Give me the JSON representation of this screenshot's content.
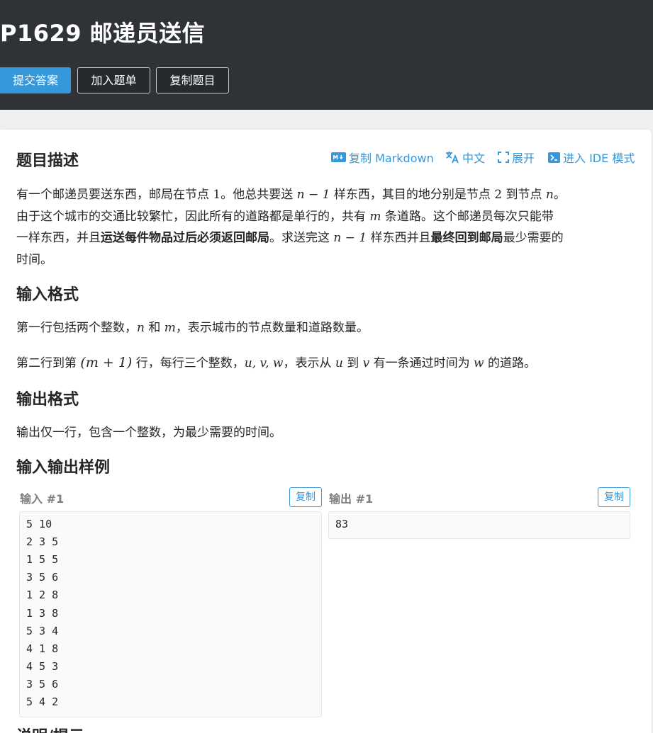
{
  "header": {
    "title": "P1629 邮递员送信",
    "submit_label": "提交答案",
    "add_label": "加入题单",
    "copy_label": "复制题目"
  },
  "toolbar": {
    "markdown_icon": "markdown-icon",
    "markdown_label": "复制 Markdown",
    "translate_icon": "translate-icon",
    "lang_label": "中文",
    "expand_icon": "expand-icon",
    "expand_label": "展开",
    "ide_icon": "terminal-icon",
    "ide_label": "进入 IDE 模式"
  },
  "description": {
    "heading": "题目描述",
    "line1": {
      "a": "有一个邮递员要送东西，邮局在节点 ",
      "b": "1",
      "c": "。他总共要送 ",
      "d": "n − 1",
      "e": " 样东西，其目的地分别是节点 ",
      "f": "2",
      "g": " 到节点 ",
      "h": "n",
      "i": "。"
    },
    "line2": {
      "a": "由于这个城市的交通比较繁忙，因此所有的道路都是单行的，共有 ",
      "b": "m",
      "c": " 条道路。这个邮递员每次只能带"
    },
    "line3": {
      "a": "一样东西，并且",
      "b": "运送每件物品过后必须返回邮局",
      "c": "。求送完这 ",
      "d": "n − 1",
      "e": " 样东西并且",
      "f": "最终回到邮局",
      "g": "最少需要的"
    },
    "line4": "时间。"
  },
  "input_format": {
    "heading": "输入格式",
    "line1": {
      "a": "第一行包括两个整数，",
      "b": "n",
      "c": " 和 ",
      "d": "m",
      "e": "，表示城市的节点数量和道路数量。"
    },
    "line2": {
      "a": "第二行到第 ",
      "b": "(m + 1)",
      "c": " 行，每行三个整数，",
      "d": "u, v, w",
      "e": "，表示从 ",
      "f": "u",
      "g": " 到 ",
      "h": "v",
      "i": " 有一条通过时间为 ",
      "j": "w",
      "k": " 的道路。"
    }
  },
  "output_format": {
    "heading": "输出格式",
    "line1": "输出仅一行，包含一个整数，为最少需要的时间。"
  },
  "samples": {
    "heading": "输入输出样例",
    "input_label": "输入 #1",
    "output_label": "输出 #1",
    "copy_label": "复制",
    "input_lines": [
      "5 10",
      "2 3 5",
      "1 5 5",
      "3 5 6",
      "1 2 8",
      "1 3 8",
      "5 3 4",
      "4 1 8",
      "4 5 3",
      "3 5 6",
      "5 4 2"
    ],
    "output_lines": [
      "83"
    ]
  },
  "hint": {
    "heading": "说明/提示"
  },
  "colors": {
    "topbar": "#2f3236",
    "accent": "#3498db",
    "text": "#262626",
    "muted": "#7f7f7f"
  }
}
